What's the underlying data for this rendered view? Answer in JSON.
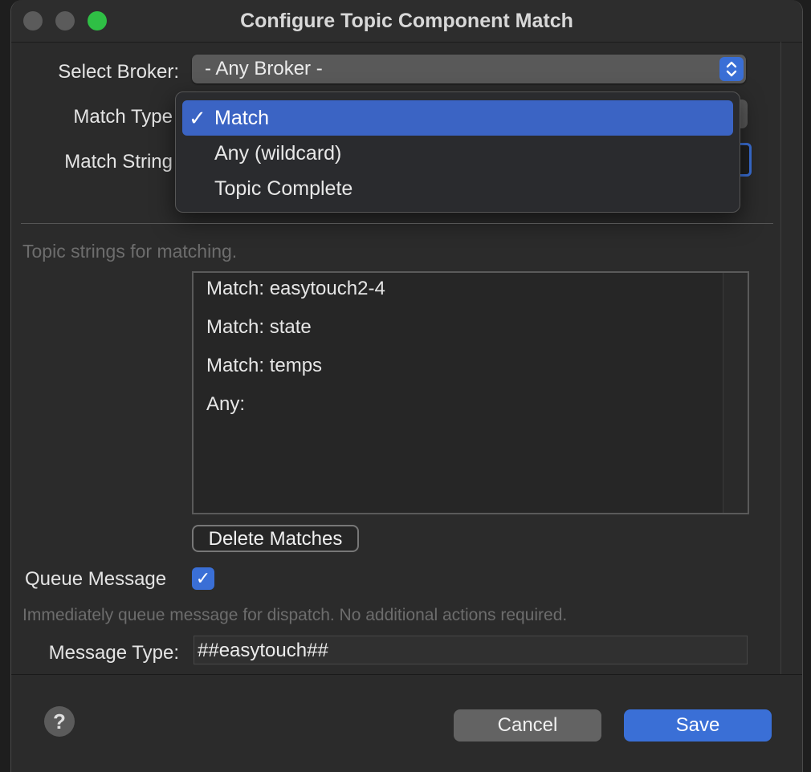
{
  "window": {
    "title": "Configure Topic Component Match"
  },
  "form": {
    "broker_label": "Select Broker:",
    "broker_value": "- Any Broker -",
    "match_type_label": "Match Type",
    "match_string_label": "Match String"
  },
  "match_type_menu": {
    "items": [
      {
        "label": "Match",
        "selected": true
      },
      {
        "label": "Any (wildcard)",
        "selected": false
      },
      {
        "label": "Topic Complete",
        "selected": false
      }
    ],
    "check_glyph": "✓"
  },
  "topic_section": {
    "hint": "Topic strings for matching.",
    "items": [
      "Match: easytouch2-4",
      "Match: state",
      "Match: temps",
      "Any:"
    ],
    "delete_label": "Delete Matches"
  },
  "queue": {
    "label": "Queue Message",
    "checked": true,
    "check_glyph": "✓",
    "hint": "Immediately queue message for dispatch.  No additional actions required."
  },
  "message_type": {
    "label": "Message Type:",
    "value": "##easytouch##"
  },
  "footer": {
    "help_glyph": "?",
    "cancel_label": "Cancel",
    "save_label": "Save"
  },
  "colors": {
    "accent": "#3a6fd6",
    "background": "#2b2b2b",
    "menu_selection": "#3b64c4"
  }
}
